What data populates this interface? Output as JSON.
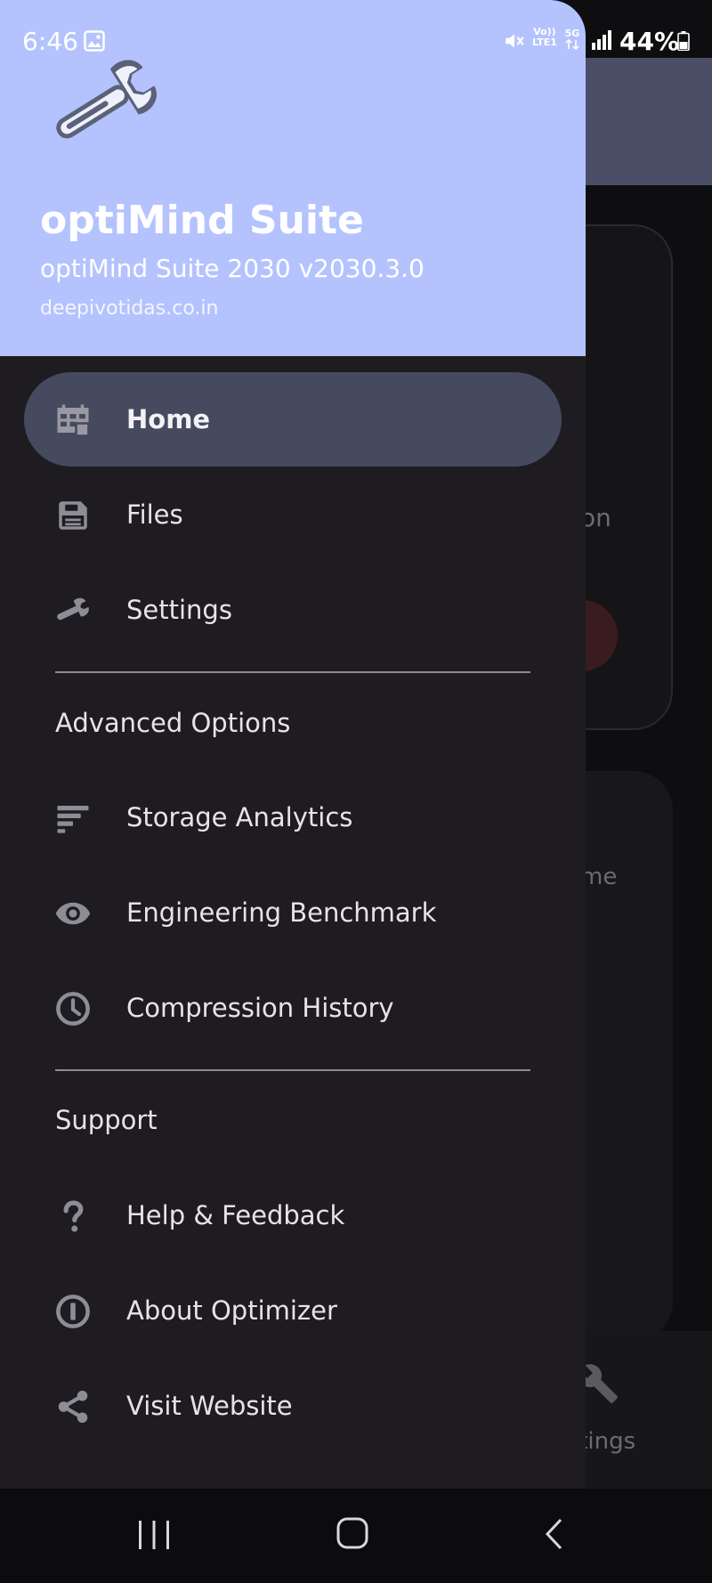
{
  "status_bar": {
    "time": "6:46",
    "battery": "44%",
    "volte_line1": "Vo))",
    "volte_line2": "LTE1",
    "network": "5G"
  },
  "background": {
    "card1_text": "on",
    "card2_text": "me",
    "bottom_nav_label": "ttings"
  },
  "drawer": {
    "header": {
      "title": "optiMind Suite",
      "subtitle": "optiMind Suite 2030 v2030.3.0",
      "url": "deepivotidas.co.in",
      "logo_icon": "wrench-icon",
      "header_color": "#b4c3fe"
    },
    "items": [
      {
        "label": "Home",
        "icon": "dashboard-icon",
        "active": true
      },
      {
        "label": "Files",
        "icon": "save-icon",
        "active": false
      },
      {
        "label": "Settings",
        "icon": "wrench-icon",
        "active": false
      }
    ],
    "advanced": {
      "header": "Advanced Options",
      "items": [
        {
          "label": "Storage Analytics",
          "icon": "sort-lines-icon"
        },
        {
          "label": "Engineering Benchmark",
          "icon": "eye-icon"
        },
        {
          "label": "Compression History",
          "icon": "clock-icon"
        }
      ]
    },
    "support": {
      "header": "Support",
      "items": [
        {
          "label": "Help & Feedback",
          "icon": "question-icon"
        },
        {
          "label": "About Optimizer",
          "icon": "info-icon"
        },
        {
          "label": "Visit Website",
          "icon": "share-icon"
        }
      ]
    },
    "active_color": "#454a5e"
  }
}
